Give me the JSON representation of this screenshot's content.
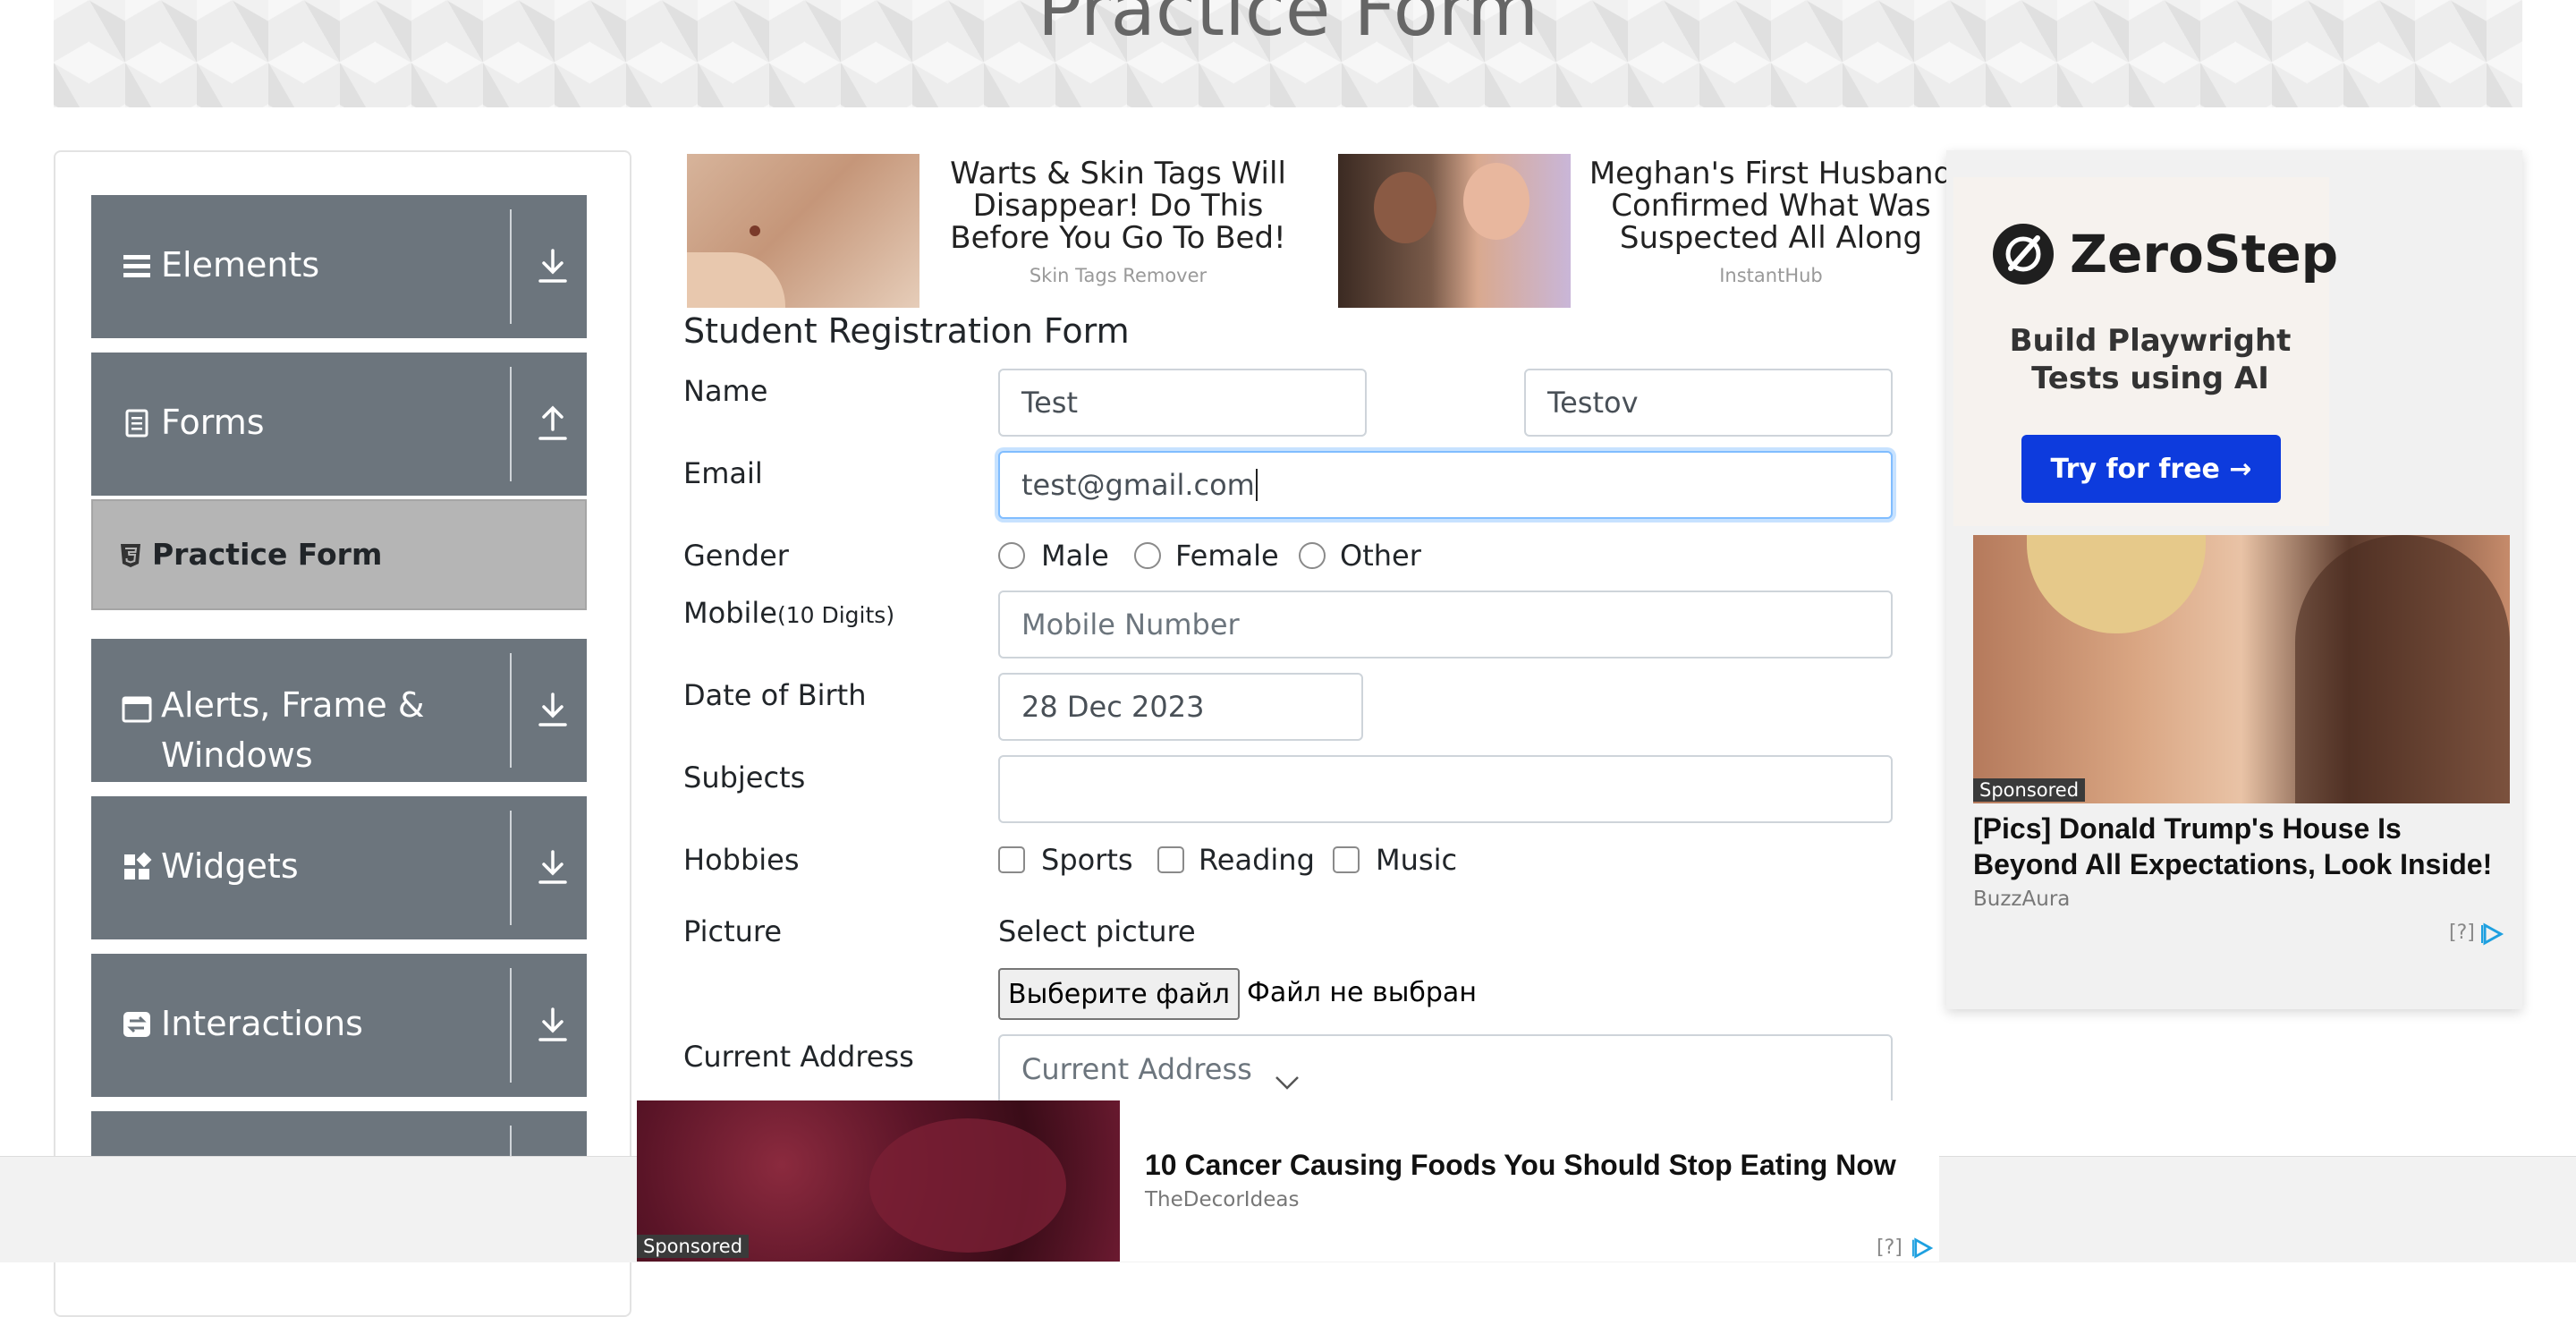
{
  "header": {
    "title": "Practice Form"
  },
  "sidebar": {
    "groups": [
      {
        "label": "Elements",
        "icon": "menu-icon",
        "arrow": "download-icon"
      },
      {
        "label": "Forms",
        "icon": "document-icon",
        "arrow": "upload-icon"
      },
      {
        "label": "Alerts, Frame &",
        "label2": "Windows",
        "icon": "window-icon",
        "arrow": "download-icon"
      },
      {
        "label": "Widgets",
        "icon": "widgets-icon",
        "arrow": "download-icon"
      },
      {
        "label": "Interactions",
        "icon": "interactions-icon",
        "arrow": "download-icon"
      }
    ],
    "active_item": {
      "label": "Practice Form",
      "icon": "html5-icon"
    }
  },
  "top_ads": [
    {
      "headline": "Warts & Skin Tags Will Disappear! Do This Before You Go To Bed!",
      "source": "Skin Tags Remover"
    },
    {
      "headline": "Meghan's First Husband Confirmed What Was Suspected All Along",
      "source": "InstantHub"
    }
  ],
  "form": {
    "title": "Student Registration Form",
    "name_label": "Name",
    "first_name": "Test",
    "last_name": "Testov",
    "email_label": "Email",
    "email_value": "test@gmail.com",
    "gender_label": "Gender",
    "gender_options": [
      "Male",
      "Female",
      "Other"
    ],
    "mobile_label": "Mobile",
    "mobile_hint": "(10 Digits)",
    "mobile_placeholder": "Mobile Number",
    "dob_label": "Date of Birth",
    "dob_value": "28 Dec 2023",
    "subjects_label": "Subjects",
    "hobbies_label": "Hobbies",
    "hobbies": [
      "Sports",
      "Reading",
      "Music"
    ],
    "picture_label": "Picture",
    "picture_caption": "Select picture",
    "file_button": "Выберите файл",
    "file_status": "Файл не выбран",
    "address_label": "Current Address",
    "address_placeholder": "Current Address"
  },
  "right_ad": {
    "brand": "ZeroStep",
    "tagline": "Build Playwright Tests using AI",
    "cta": "Try for free →",
    "sponsored": "Sponsored",
    "headline": "[Pics] Donald Trump's House Is Beyond All Expectations, Look Inside!",
    "source": "BuzzAura",
    "adchoice": "[?]"
  },
  "bottom_ad": {
    "sponsored": "Sponsored",
    "headline": "10 Cancer Causing Foods You Should Stop Eating Now",
    "source": "TheDecorIdeas",
    "adchoice": "[?]"
  },
  "colors": {
    "nav_bg": "#6c757d",
    "active_bg": "#b5b5b5",
    "cta_blue": "#0d3bdd"
  }
}
